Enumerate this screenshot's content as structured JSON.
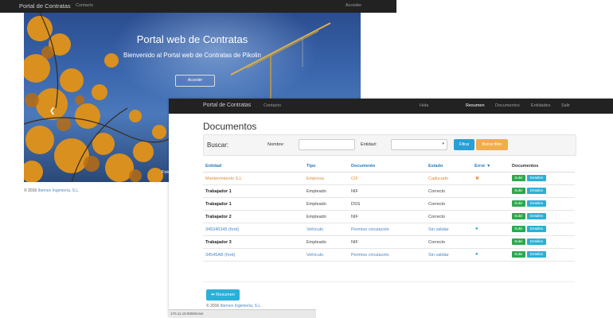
{
  "home": {
    "nav": {
      "brand": "Portal de Contratas",
      "contacto": "Contacto",
      "acceder": "Acceder"
    },
    "hero": {
      "title": "Portal web de Contratas",
      "subtitle": "Bienvenido al Portal web de Contratas de Pikolin",
      "button": "Acceder",
      "caption": "Foto portada",
      "prev_icon": "chevron-left-icon"
    },
    "footer": {
      "copyright": "© 2016",
      "company": "Ibernex Ingeniería, S.L."
    }
  },
  "app": {
    "nav": {
      "brand": "Portal de Contratas",
      "contacto": "Contacto",
      "hola": "Hola",
      "resumen": "Resumen",
      "documentos": "Documentos",
      "entidades": "Entidades",
      "salir": "Salir"
    },
    "title": "Documentos",
    "filter": {
      "buscar": "Buscar:",
      "nombre_label": "Nombre:",
      "nombre_value": "",
      "entidad_label": "Entidad:",
      "entidad_value": "",
      "filtrar": "Filtrar",
      "borrar": "Borrar filtro"
    },
    "table": {
      "headers": {
        "entidad": "Entidad",
        "tipo": "Tipo",
        "documento": "Documento",
        "estado": "Estado",
        "error": "Error ▼",
        "documentos": "Documentos"
      },
      "action_subir": "Subir",
      "action_detalles": "Detalles",
      "rows": [
        {
          "entidad": "Mantenimiento S.L",
          "tipo": "Empresa",
          "documento": "CIF",
          "estado": "Caducado",
          "error": "✖",
          "style": "warn"
        },
        {
          "entidad": "Trabajador 1",
          "tipo": "Empleado",
          "documento": "NIF",
          "estado": "Correcto",
          "error": "",
          "style": "plain"
        },
        {
          "entidad": "Trabajador 1",
          "tipo": "Empleado",
          "documento": "DSS",
          "estado": "Correcto",
          "error": "",
          "style": "plain"
        },
        {
          "entidad": "Trabajador 2",
          "tipo": "Empleado",
          "documento": "NIF",
          "estado": "Correcto",
          "error": "",
          "style": "plain"
        },
        {
          "entidad": "345345345 (ford)",
          "tipo": "Vehículo",
          "documento": "Permiso circulación",
          "estado": "Sin validar",
          "error": "●",
          "style": "link"
        },
        {
          "entidad": "Trabajador 3",
          "tipo": "Empleado",
          "documento": "NIF",
          "estado": "Correcto",
          "error": "",
          "style": "plain"
        },
        {
          "entidad": "34545AB (ford)",
          "tipo": "Vehículo",
          "documento": "Permiso circulación",
          "estado": "Sin validar",
          "error": "●",
          "style": "link"
        }
      ]
    },
    "resumen_button": "Resumen",
    "footer": {
      "copyright": "© 2016",
      "company": "Ibernex Ingeniería, S.L."
    },
    "status_url": "170.11.15:8080/User",
    "colors": {
      "navbar": "#222222",
      "primary": "#2a9fd6",
      "warning": "#f0ad4e",
      "success": "#2ca84e",
      "info": "#2ab0d9",
      "caducado": "#d98c36"
    }
  }
}
